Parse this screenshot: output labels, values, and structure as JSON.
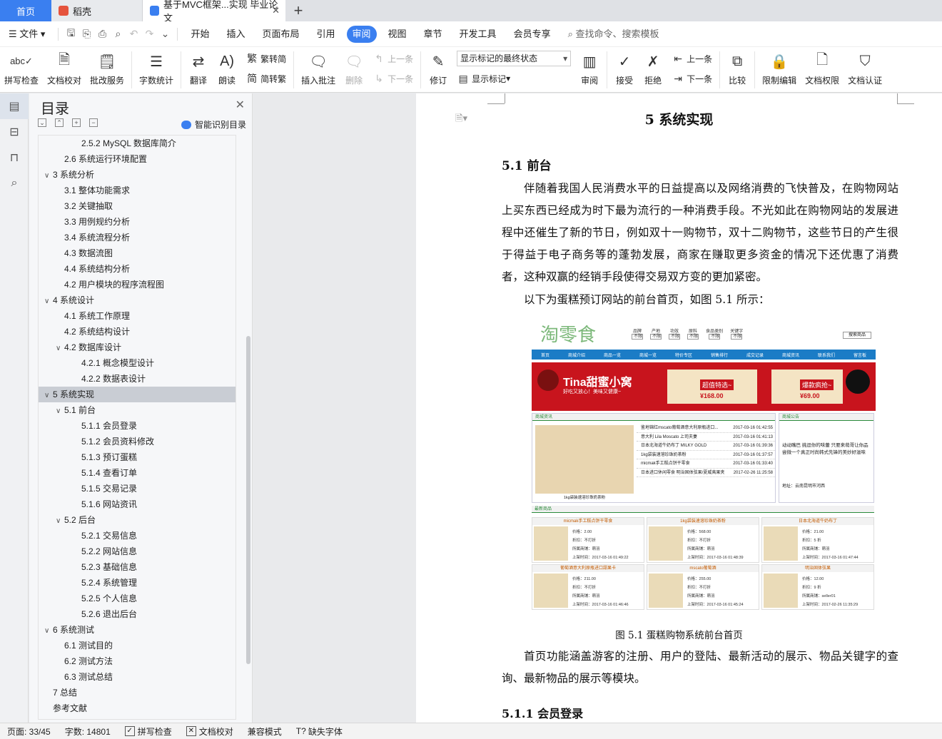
{
  "tabs": [
    {
      "label": "首页",
      "icon": "home-tab"
    },
    {
      "label": "稻壳",
      "icon": "daoke-logo-icon"
    },
    {
      "label": "基于MVC框架...实现 毕业论文",
      "icon": "word-doc-icon"
    }
  ],
  "menu": {
    "file_label": "文件",
    "items": [
      "开始",
      "插入",
      "页面布局",
      "引用",
      "审阅",
      "视图",
      "章节",
      "开发工具",
      "会员专享"
    ],
    "active": "审阅",
    "search_placeholder": "查找命令、搜索模板"
  },
  "ribbon": {
    "spellcheck": "拼写检查",
    "proofread": "文档校对",
    "batch_service": "批改服务",
    "word_count": "字数统计",
    "translate": "翻译",
    "read_aloud": "朗读",
    "to_traditional": "繁转简",
    "to_simplified": "简转繁",
    "insert_comment": "插入批注",
    "delete": "删除",
    "prev_comment": "上一条",
    "next_comment": "下一条",
    "track": "修订",
    "markup_select": "显示标记的最终状态",
    "show_markup": "显示标记",
    "review": "审阅",
    "accept": "接受",
    "reject": "拒绝",
    "prev_change": "上一条",
    "next_change": "下一条",
    "compare": "比较",
    "restrict_edit": "限制编辑",
    "doc_rights": "文档权限",
    "doc_cert": "文档认证"
  },
  "toc": {
    "title": "目录",
    "smart_label": "智能识别目录",
    "items": [
      {
        "level": 3,
        "text": "2.5.2 MySQL 数据库简介",
        "caret": ""
      },
      {
        "level": 2,
        "text": "2.6  系统运行环境配置",
        "caret": ""
      },
      {
        "level": 1,
        "text": "3  系统分析",
        "caret": "∨"
      },
      {
        "level": 2,
        "text": "3.1  整体功能需求",
        "caret": ""
      },
      {
        "level": 2,
        "text": "3.2  关键抽取",
        "caret": ""
      },
      {
        "level": 2,
        "text": "3.3  用例规约分析",
        "caret": ""
      },
      {
        "level": 2,
        "text": "3.4  系统流程分析",
        "caret": ""
      },
      {
        "level": 2,
        "text": "4.3  数据流图",
        "caret": ""
      },
      {
        "level": 2,
        "text": "4.4  系统结构分析",
        "caret": ""
      },
      {
        "level": 2,
        "text": "4.2  用户模块的程序流程图",
        "caret": ""
      },
      {
        "level": 1,
        "text": "4  系统设计",
        "caret": "∨"
      },
      {
        "level": 2,
        "text": "4.1  系统工作原理",
        "caret": ""
      },
      {
        "level": 2,
        "text": "4.2  系统结构设计",
        "caret": ""
      },
      {
        "level": 2,
        "text": "4.2 数据库设计",
        "caret": "∨"
      },
      {
        "level": 3,
        "text": "4.2.1  概念模型设计",
        "caret": ""
      },
      {
        "level": 3,
        "text": "4.2.2  数据表设计",
        "caret": ""
      },
      {
        "level": 1,
        "text": "5  系统实现",
        "caret": "∨",
        "selected": true
      },
      {
        "level": 2,
        "text": "5.1  前台",
        "caret": "∨"
      },
      {
        "level": 3,
        "text": "5.1.1  会员登录",
        "caret": ""
      },
      {
        "level": 3,
        "text": "5.1.2  会员资料修改",
        "caret": ""
      },
      {
        "level": 3,
        "text": "5.1.3  预订蛋糕",
        "caret": ""
      },
      {
        "level": 3,
        "text": "5.1.4  查看订单",
        "caret": ""
      },
      {
        "level": 3,
        "text": "5.1.5  交易记录",
        "caret": ""
      },
      {
        "level": 3,
        "text": "5.1.6  网站资讯",
        "caret": ""
      },
      {
        "level": 2,
        "text": "5.2  后台",
        "caret": "∨"
      },
      {
        "level": 3,
        "text": "5.2.1  交易信息",
        "caret": ""
      },
      {
        "level": 3,
        "text": "5.2.2  网站信息",
        "caret": ""
      },
      {
        "level": 3,
        "text": "5.2.3  基础信息",
        "caret": ""
      },
      {
        "level": 3,
        "text": "5.2.4  系统管理",
        "caret": ""
      },
      {
        "level": 3,
        "text": "5.2.5  个人信息",
        "caret": ""
      },
      {
        "level": 3,
        "text": "5.2.6  退出后台",
        "caret": ""
      },
      {
        "level": 1,
        "text": "6  系统测试",
        "caret": "∨"
      },
      {
        "level": 2,
        "text": "6.1  测试目的",
        "caret": ""
      },
      {
        "level": 2,
        "text": "6.2  测试方法",
        "caret": ""
      },
      {
        "level": 2,
        "text": "6.3  测试总结",
        "caret": ""
      },
      {
        "level": 1,
        "text": "7  总结",
        "caret": ""
      },
      {
        "level": 1,
        "text": "参考文献",
        "caret": ""
      }
    ]
  },
  "document": {
    "chapter_title": "5  系统实现",
    "section_title": "5.1  前台",
    "para1": "伴随着我国人民消费水平的日益提高以及网络消费的飞快普及，在购物网站上买东西已经成为时下最为流行的一种消费手段。不光如此在购物网站的发展进程中还催生了新的节日，例如双十一购物节，双十二购物节，这些节日的产生很于得益于电子商务等的蓬勃发展，商家在赚取更多资金的情况下还优惠了消费者，这种双赢的经销手段使得交易双方变的更加紧密。",
    "para2": "以下为蛋糕预订网站的前台首页，如图 5.1 所示：",
    "caption": "图 5.1   蛋糕购物系统前台首页",
    "para3": "首页功能涵盖游客的注册、用户的登陆、最新活动的展示、物品关键字的查询、最新物品的展示等模块。",
    "subsection_title": "5.1.1  会员登录"
  },
  "figure": {
    "logo": "淘零食",
    "filters": [
      "品牌",
      "产地",
      "功效",
      "原料",
      "食品类别",
      "关键字"
    ],
    "filter_value": "不限",
    "search_btn": "搜索商品",
    "nav": [
      "首页",
      "商城介绍",
      "商品一览",
      "商城一览",
      "特价专区",
      "销售排行",
      "成交记录",
      "商城资讯",
      "联系我们",
      "留言板"
    ],
    "banner_title": "Tina甜蜜小窝",
    "banner_sub": "好吃又放心！美味又健康~",
    "deal1": "超值特选~",
    "price1": "¥168.00",
    "deal2": "爆款疯抢~",
    "price2": "¥69.00",
    "news_header": "商城资讯",
    "news": [
      {
        "t": "鉴地锦红mscato葡萄酒意大利原瓶进口...",
        "d": "2017-03-16 01:42:55"
      },
      {
        "t": "意大利 Lila Moscato 上司夫妻",
        "d": "2017-03-16 01:41:13"
      },
      {
        "t": "日本北海道牛奶布丁 MILKY GOLD",
        "d": "2017-03-16 01:39:36"
      },
      {
        "t": "1kg袋装速溶珍珠奶茶粉",
        "d": "2017-03-16 01:37:57"
      },
      {
        "t": "micmak手工糕点饼干零食",
        "d": "2017-03-16 01:33:40"
      },
      {
        "t": "日本进口休闲零食 明治固体弦果/夏威夷果夹",
        "d": "2017-02-26 11:25:58"
      }
    ],
    "notice_header": "商城公告",
    "notice_text": "动动嘴巴 挑逗你的味蕾 只要来萌哥让你品尝微一个真正时尚韩式先锋的美妙好滋味",
    "notice_addr": "地址：云南昆明市河西",
    "img_caption": "1kg袋装速溶珍珠奶茶粉",
    "newest_header": "最新商品",
    "products": [
      {
        "n": "micmak手工糕点饼干零食",
        "price": "2.00",
        "disc": "不打折",
        "shop": "萌羽",
        "time": "2017-03-16 01:49:22"
      },
      {
        "n": "1kg袋装速溶珍珠奶茶粉",
        "price": "568.00",
        "disc": "不打折",
        "shop": "萌羽",
        "time": "2017-03-16 01:48:39"
      },
      {
        "n": "日本北海道牛奶布丁",
        "price": "21.00",
        "disc": "5 折",
        "shop": "萌羽",
        "time": "2017-03-16 01:47:44"
      },
      {
        "n": "葡萄酒意大利原瓶进口甜果卡",
        "price": "211.00",
        "disc": "不打折",
        "shop": "萌羽",
        "time": "2017-03-16 01:46:46"
      },
      {
        "n": "mscato葡萄酒",
        "price": "255.00",
        "disc": "不打折",
        "shop": "萌羽",
        "time": "2017-03-16 01:45:24"
      },
      {
        "n": "明治固体弦果",
        "price": "12.00",
        "disc": "9 折",
        "shop": "seller01",
        "time": "2017-02-26 11:35:29"
      }
    ]
  },
  "status": {
    "page": "页面: 33/45",
    "words": "字数: 14801",
    "spellcheck": "拼写检查",
    "proofread": "文档校对",
    "compat": "兼容模式",
    "missing_font": "缺失字体"
  }
}
